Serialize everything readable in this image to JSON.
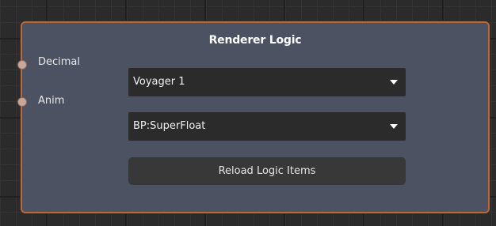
{
  "node": {
    "title": "Renderer Logic",
    "ports": [
      {
        "label": "Decimal"
      },
      {
        "label": "Anim"
      }
    ],
    "dropdowns": [
      {
        "value": "Voyager 1",
        "icon": "chevron-down-icon"
      },
      {
        "value": "BP:SuperFloat",
        "icon": "chevron-down-icon"
      }
    ],
    "reload_button_label": "Reload Logic Items"
  },
  "colors": {
    "node_border": "#b46a3c",
    "node_background": "#4c5262",
    "port": "#c7a79a",
    "dropdown_background": "#2b2b2b",
    "button_background": "#383838"
  }
}
